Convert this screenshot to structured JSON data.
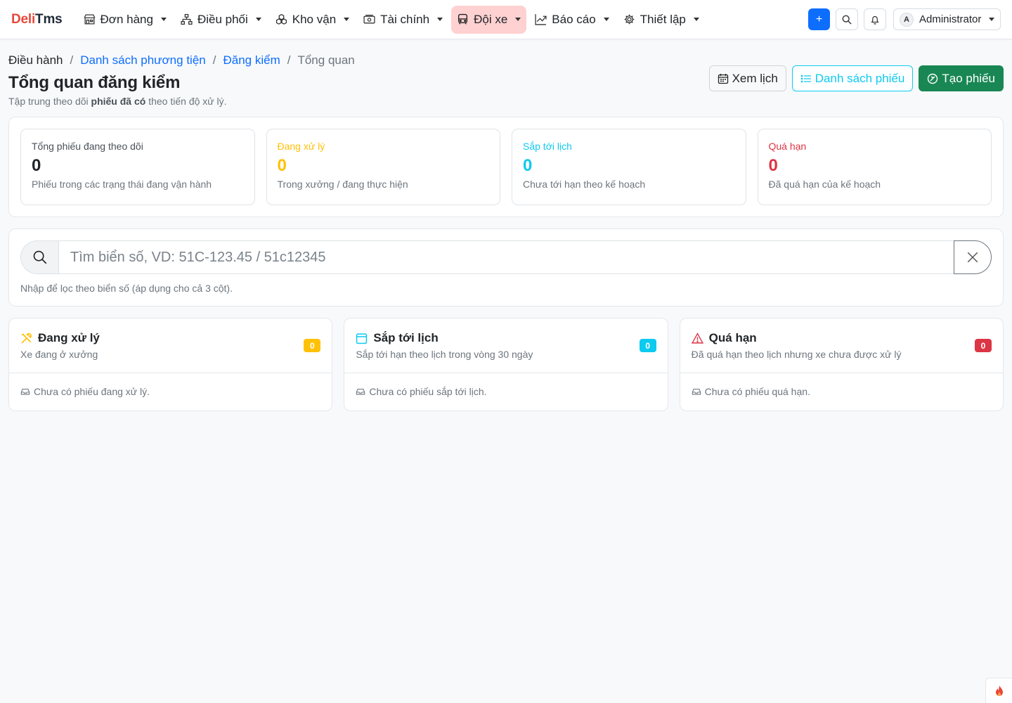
{
  "brand": {
    "part1": "Deli",
    "part2": "Tms",
    "color1": "#e8483a"
  },
  "nav": {
    "items": [
      {
        "label": "Đơn hàng",
        "icon": "shop-icon"
      },
      {
        "label": "Điều phối",
        "icon": "diagram-icon"
      },
      {
        "label": "Kho vận",
        "icon": "boxes-icon"
      },
      {
        "label": "Tài chính",
        "icon": "cash-icon"
      },
      {
        "label": "Đội xe",
        "icon": "bus-icon",
        "active": true
      },
      {
        "label": "Báo cáo",
        "icon": "graph-icon"
      },
      {
        "label": "Thiết lập",
        "icon": "gear-icon"
      }
    ],
    "active_bg": "#ffd1d1",
    "plus_label": "+",
    "user": {
      "initial": "A",
      "name": "Administrator"
    }
  },
  "breadcrumb": {
    "root": "Điều hành",
    "vehicles": "Danh sách phương tiện",
    "inspection": "Đăng kiểm",
    "current": "Tổng quan"
  },
  "page": {
    "title": "Tổng quan đăng kiểm",
    "subtitle_pre": "Tập trung theo dõi ",
    "subtitle_bold": "phiếu đã có",
    "subtitle_post": " theo tiến độ xử lý."
  },
  "actions": {
    "calendar": "Xem lịch",
    "list": "Danh sách phiếu",
    "create": "Tạo phiếu"
  },
  "stats": [
    {
      "label": "Tổng phiếu đang theo dõi",
      "value": "0",
      "desc": "Phiếu trong các trạng thái đang vận hành",
      "color": "#212529"
    },
    {
      "label": "Đang xử lý",
      "value": "0",
      "desc": "Trong xưởng / đang thực hiện",
      "color": "#ffc107"
    },
    {
      "label": "Sắp tới lịch",
      "value": "0",
      "desc": "Chưa tới hạn theo kế hoạch",
      "color": "#0dcaf0"
    },
    {
      "label": "Quá hạn",
      "value": "0",
      "desc": "Đã quá hạn của kế hoạch",
      "color": "#dc3545"
    }
  ],
  "search": {
    "placeholder": "Tìm biển số, VD: 51C-123.45 / 51c12345",
    "value": "",
    "hint": "Nhập để lọc theo biển số (áp dụng cho cả 3 cột)."
  },
  "columns": [
    {
      "title": "Đang xử lý",
      "subtitle": "Xe đang ở xưởng",
      "count": "0",
      "empty": "Chưa có phiếu đang xử lý.",
      "icon": "tools-icon",
      "color": "#ffc107"
    },
    {
      "title": "Sắp tới lịch",
      "subtitle": "Sắp tới hạn theo lịch trong vòng 30 ngày",
      "count": "0",
      "empty": "Chưa có phiếu sắp tới lịch.",
      "icon": "calendar-icon",
      "color": "#0dcaf0"
    },
    {
      "title": "Quá hạn",
      "subtitle": "Đã quá hạn theo lịch nhưng xe chưa được xử lý",
      "count": "0",
      "empty": "Chưa có phiếu quá hạn.",
      "icon": "warning-icon",
      "color": "#dc3545"
    }
  ]
}
